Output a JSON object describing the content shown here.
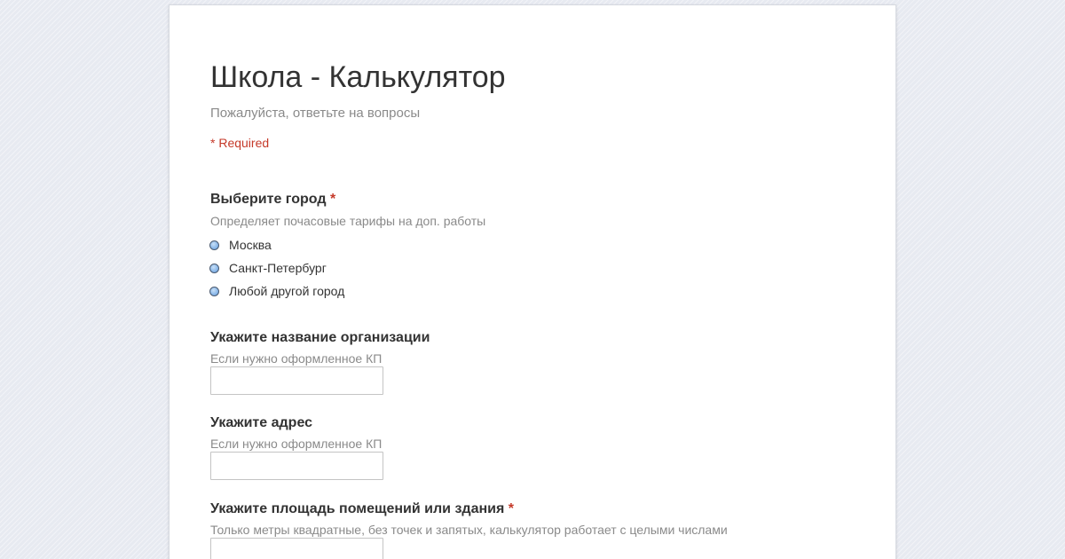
{
  "form": {
    "title": "Школа - Калькулятор",
    "description": "Пожалуйста, ответьте на вопросы",
    "required_note": "* Required"
  },
  "questions": [
    {
      "title": "Выберите город",
      "required_mark": "*",
      "help": "Определяет почасовые тарифы на доп. работы",
      "type": "radio",
      "options": [
        "Москва",
        "Санкт-Петербург",
        "Любой другой город"
      ]
    },
    {
      "title": "Укажите название организации",
      "help": "Если нужно оформленное КП",
      "type": "text",
      "value": ""
    },
    {
      "title": "Укажите адрес",
      "help": "Если нужно оформленное КП",
      "type": "text",
      "value": ""
    },
    {
      "title": "Укажите площадь помещений или здания",
      "required_mark": "*",
      "help": "Только метры квадратные, без точек и запятых, калькулятор работает с целыми числами",
      "type": "text",
      "value": ""
    }
  ],
  "colors": {
    "background": "#e7eaf1",
    "card": "#ffffff",
    "required": "#c53929",
    "radio_fill": "#7fb0e6"
  }
}
